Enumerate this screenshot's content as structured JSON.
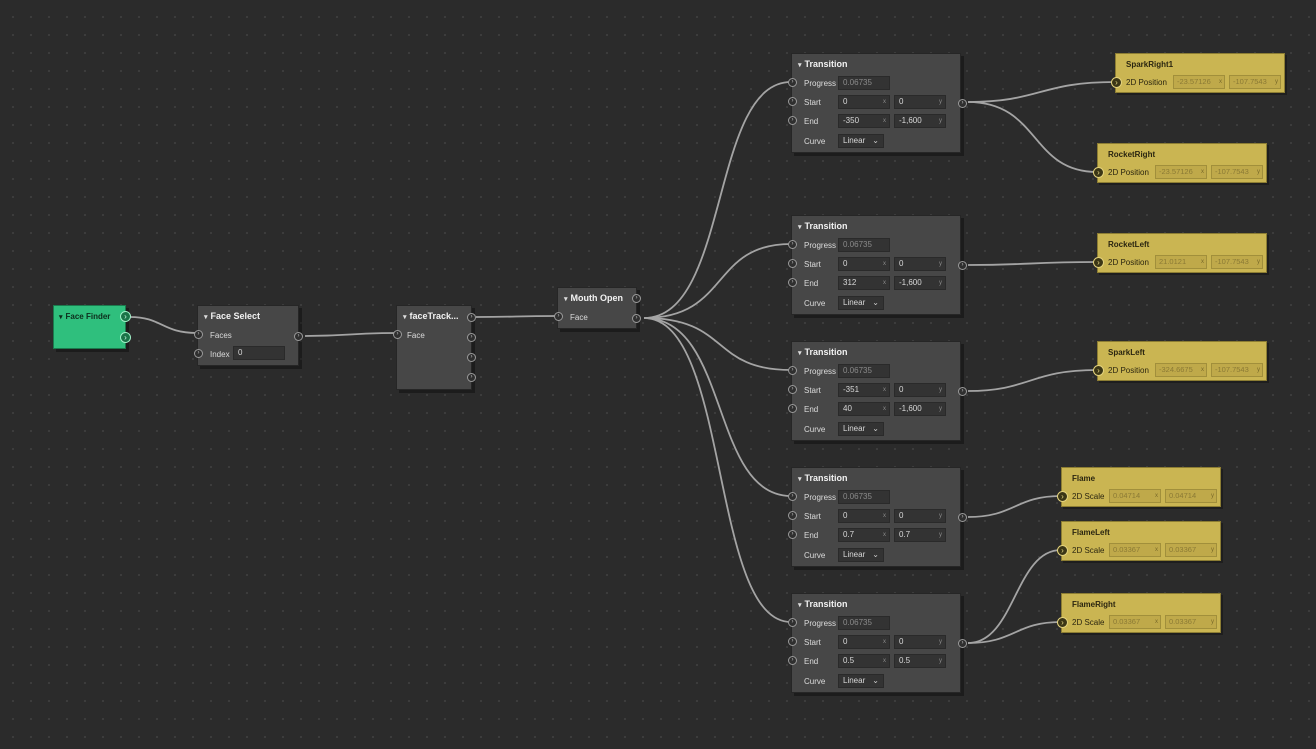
{
  "nodes": {
    "face_finder": {
      "title": "Face Finder"
    },
    "face_select": {
      "title": "Face Select",
      "inputs": [
        "Faces",
        "Index"
      ],
      "index_value": "0"
    },
    "face_tracker": {
      "title": "faceTrack...",
      "inputs": [
        "Face"
      ]
    },
    "mouth_open": {
      "title": "Mouth Open",
      "inputs": [
        "Face"
      ]
    }
  },
  "transition_labels": {
    "title": "Transition",
    "progress": "Progress",
    "start": "Start",
    "end": "End",
    "curve": "Curve",
    "x": "x",
    "y": "y"
  },
  "transitions": [
    {
      "progress": "0.06735",
      "start": [
        "0",
        "0"
      ],
      "end": [
        "-350",
        "-1,600"
      ],
      "curve": "Linear"
    },
    {
      "progress": "0.06735",
      "start": [
        "0",
        "0"
      ],
      "end": [
        "312",
        "-1,600"
      ],
      "curve": "Linear"
    },
    {
      "progress": "0.06735",
      "start": [
        "-351",
        "0"
      ],
      "end": [
        "40",
        "-1,600"
      ],
      "curve": "Linear"
    },
    {
      "progress": "0.06735",
      "start": [
        "0",
        "0"
      ],
      "end": [
        "0.7",
        "0.7"
      ],
      "curve": "Linear"
    },
    {
      "progress": "0.06735",
      "start": [
        "0",
        "0"
      ],
      "end": [
        "0.5",
        "0.5"
      ],
      "curve": "Linear"
    }
  ],
  "targets": [
    {
      "title": "SparkRight1",
      "property": "2D Position",
      "values": [
        "-23.57126",
        "-107.7543"
      ]
    },
    {
      "title": "RocketRight",
      "property": "2D Position",
      "values": [
        "-23.57126",
        "-107.7543"
      ]
    },
    {
      "title": "RocketLeft",
      "property": "2D Position",
      "values": [
        "21.0121",
        "-107.7543"
      ]
    },
    {
      "title": "SparkLeft",
      "property": "2D Position",
      "values": [
        "-324.6675",
        "-107.7543"
      ]
    },
    {
      "title": "Flame",
      "property": "2D Scale",
      "values": [
        "0.04714",
        "0.04714"
      ]
    },
    {
      "title": "FlameLeft",
      "property": "2D Scale",
      "values": [
        "0.03367",
        "0.03367"
      ]
    },
    {
      "title": "FlameRight",
      "property": "2D Scale",
      "values": [
        "0.03367",
        "0.03367"
      ]
    }
  ],
  "colors": {
    "background": "#2b2b2b",
    "node": "#474747",
    "accent_green": "#2fbf7d",
    "accent_yellow": "#cab552",
    "wire": "#a4a4a4"
  }
}
